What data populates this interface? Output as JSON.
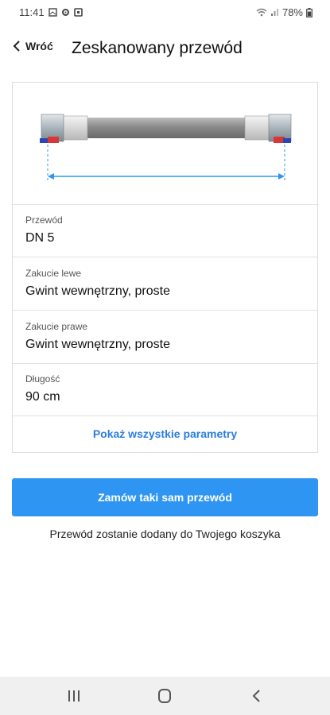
{
  "status": {
    "time": "11:41",
    "battery": "78%"
  },
  "header": {
    "back_label": "Wróć",
    "title": "Zeskanowany przewód"
  },
  "params": [
    {
      "label": "Przewód",
      "value": "DN 5"
    },
    {
      "label": "Zakucie lewe",
      "value": "Gwint wewnętrzny, proste"
    },
    {
      "label": "Zakucie prawe",
      "value": "Gwint wewnętrzny, proste"
    },
    {
      "label": "Długość",
      "value": "90 cm"
    }
  ],
  "show_all_label": "Pokaż wszystkie parametry",
  "order_button_label": "Zamów taki sam przewód",
  "order_note": "Przewód zostanie dodany do Twojego koszyka",
  "colors": {
    "accent": "#2f95f3",
    "link": "#2a7de1"
  }
}
